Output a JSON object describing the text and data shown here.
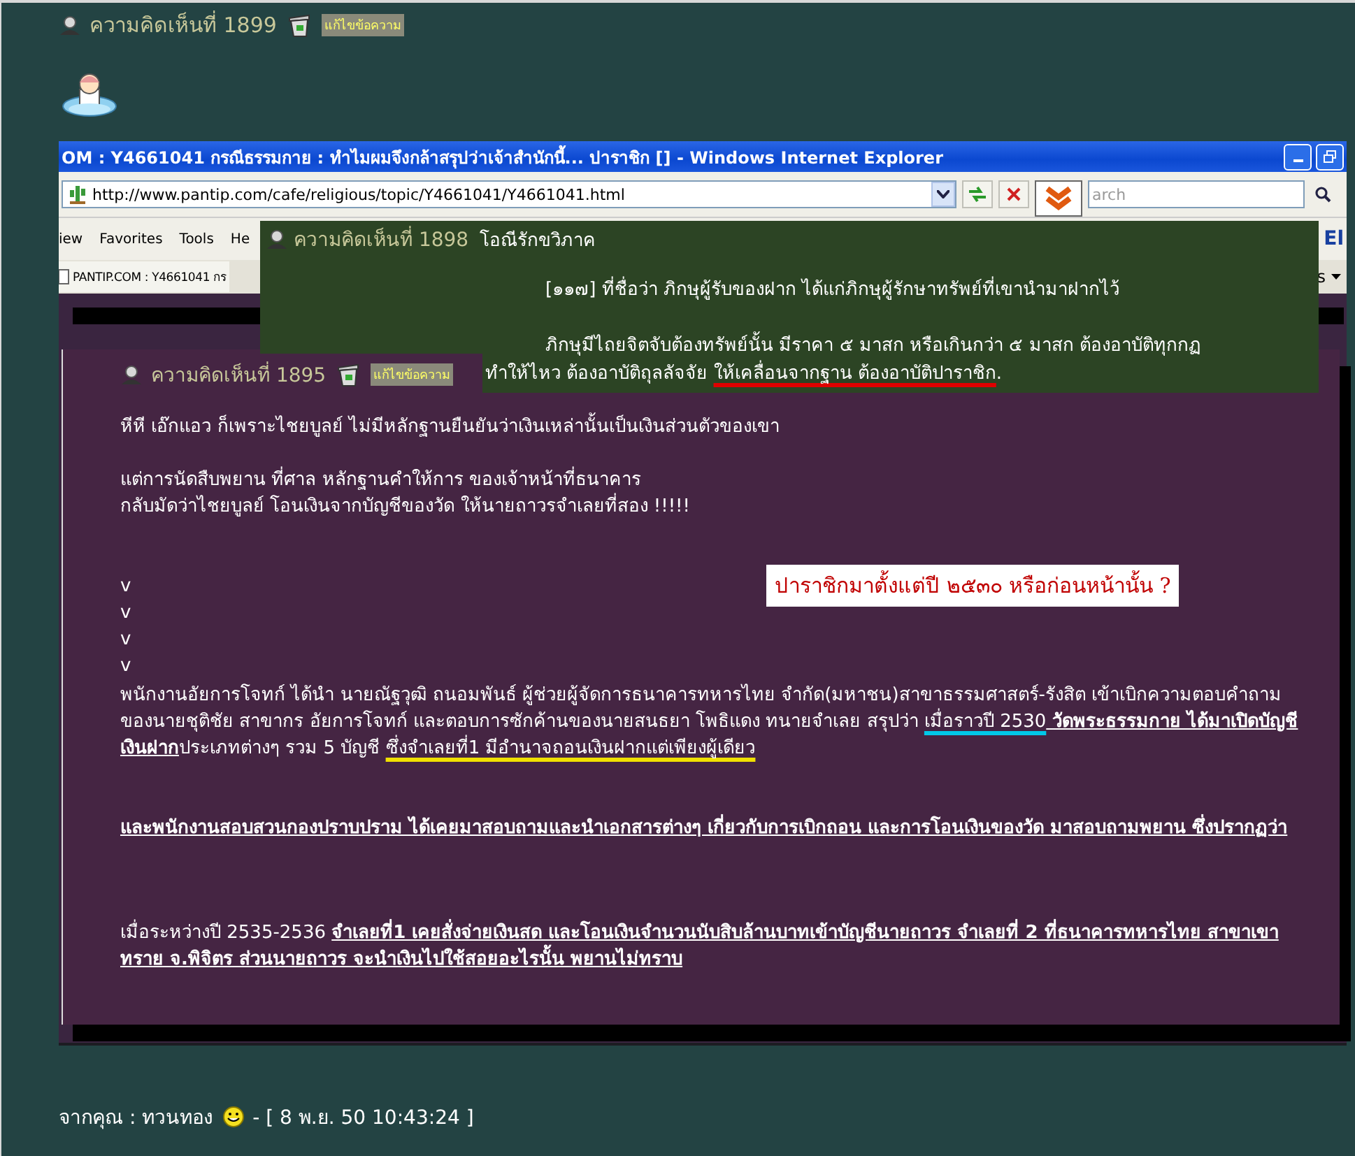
{
  "post": {
    "title": "ความคิดเห็นที่ 1899",
    "edit_label": "แก้ไขข้อความ"
  },
  "screenshot": {
    "window_title": "OM : Y4661041 กรณีธรรมกาย : ทำไมผมจึงกล้าสรุปว่าเจ้าสำนักนี้... ปาราชิก [] - Windows Internet Explorer",
    "address": "http://www.pantip.com/cafe/religious/topic/Y4661041/Y4661041.html",
    "search_placeholder": "arch",
    "menu": [
      "iew",
      "Favorites",
      "Tools",
      "He"
    ],
    "menu_right": "El",
    "tab": "PANTIP.COM : Y4661041 กร",
    "tab_right": "s",
    "overlay": {
      "title": "ความคิดเห็นที่ 1898",
      "author": "โอณีรักขวิภาค",
      "lines": [
        {
          "indent": true,
          "segments": [
            {
              "text": "[๑๑๗] ที่ชื่อว่า ภิกษุผู้รับของฝาก ได้แก่ภิกษุผู้รักษาทรัพย์ที่เขานำมาฝากไว้",
              "kind": "plain"
            }
          ]
        },
        {
          "indent": true,
          "segments": [
            {
              "text": "ภิกษุมีไถยจิตจับต้องทรัพย์นั้น มีราคา ๕ มาสก หรือเกินกว่า ๕ มาสก ต้องอาบัติทุกกฏ",
              "kind": "plain"
            }
          ]
        },
        {
          "indent": false,
          "segments": [
            {
              "text": "ทำให้ไหว ต้องอาบัติถุลลัจจัย ",
              "kind": "plain"
            },
            {
              "text": "ให้เคลื่อนจากฐาน ต้องอาบัติปาราชิก",
              "kind": "mark",
              "color": "#e00000"
            },
            {
              "text": ".",
              "kind": "plain"
            }
          ]
        }
      ]
    },
    "card": {
      "title": "ความคิดเห็นที่ 1895",
      "edit_label": "แก้ไขข้อความ",
      "paragraphs": [
        {
          "kind": "text",
          "lines": [
            "หีหี   เอ๊กแอว   ก็เพราะไชยบูลย์ ไม่มีหลักฐานยืนยันว่าเงินเหล่านั้นเป็นเงินส่วนตัวของเขา"
          ]
        },
        {
          "kind": "text",
          "lines": [
            "แต่การนัดสืบพยาน ที่ศาล  หลักฐานคำให้การ ของเจ้าหน้าที่ธนาคาร",
            "กลับมัดว่าไชยบูลย์ โอนเงินจากบัญชีของวัด  ให้นายถาวรจำเลยที่สอง  !!!!!"
          ]
        },
        {
          "kind": "arrows",
          "lines": [
            "v",
            "v",
            "v",
            "v"
          ],
          "callout": "ปาราชิกมาตั้งแต่ปี ๒๕๓๐ หรือก่อนหน้านั้น ?"
        },
        {
          "kind": "rich",
          "segments": [
            {
              "text": "พนักงานอัยการโจทก์ ได้นำ นายณัฐวุฒิ ถนอมพันธ์ ผู้ช่วยผู้จัดการธนาคารทหารไทย จำกัด(มหาชน)สาขาธรรมศาสตร์-รังสิต เข้าเบิกความตอบคำถามของนายชุติชัย สาขากร อัยการโจทก์ และตอบการซักค้านของนายสนธยา โพธิแดง ทนายจำเลย สรุปว่า ",
              "kind": "plain"
            },
            {
              "text": "เมื่อราวปี 2530",
              "kind": "mark",
              "color": "#00c8e8"
            },
            {
              "text": " วัดพระธรรมกาย ได้มาเปิดบัญชีเงินฝาก",
              "kind": "strong"
            },
            {
              "text": "ประเภทต่างๆ รวม 5 บัญชี ",
              "kind": "plain"
            },
            {
              "text": "ซึ่งจำเลยที่1 มีอำนาจถอนเงินฝากแต่เพียงผู้เดียว",
              "kind": "mark",
              "color": "#f0e000"
            }
          ]
        },
        {
          "kind": "rich",
          "segments": [
            {
              "text": "และพนักงานสอบสวนกองปราบปราม ได้เคยมาสอบถามและนำเอกสารต่างๆ เกี่ยวกับการเบิกถอน และการโอนเงินของวัด มาสอบถามพยาน ซึ่งปรากฏว่า",
              "kind": "strong"
            }
          ]
        },
        {
          "kind": "rich",
          "segments": [
            {
              "text": "เมื่อระหว่างปี 2535-2536 ",
              "kind": "plain"
            },
            {
              "text": "จำเลยที่1 เคยสั่งจ่ายเงินสด และโอนเงินจำนวนนับสิบล้านบาทเข้าบัญชีนายถาวร จำเลยที่ 2 ที่ธนาคารทหารไทย สาขาเขาทราย จ.พิจิตร ส่วนนายถาวร จะนำเงินไปใช้สอยอะไรนั้น พยานไม่ทราบ",
              "kind": "strong"
            }
          ]
        }
      ]
    }
  },
  "footer": {
    "author": "จากคุณ : ทวนทอง",
    "timestamp": "- [ 8 พ.ย. 50 10:43:24 ]"
  }
}
